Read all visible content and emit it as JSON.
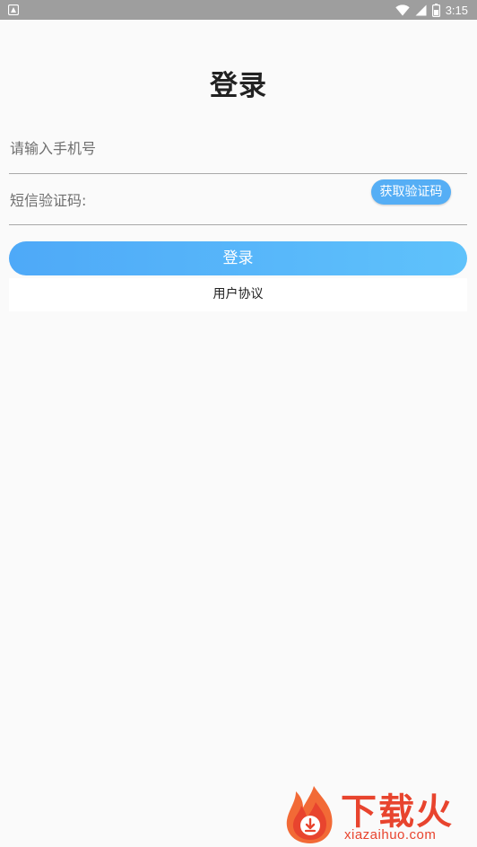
{
  "status_bar": {
    "time": "3:15",
    "icons": [
      "app-notification-icon",
      "wifi-icon",
      "signal-icon",
      "battery-icon"
    ]
  },
  "page": {
    "title": "登录"
  },
  "form": {
    "phone_placeholder": "请输入手机号",
    "phone_value": "",
    "code_placeholder": "短信验证码:",
    "code_value": "",
    "get_code_label": "获取验证码",
    "login_label": "登录",
    "agreement_label": "用户协议"
  },
  "watermark": {
    "brand": "下载火",
    "url": "xiazaihuo.com"
  },
  "colors": {
    "accent": "#55aef5",
    "gradient_start": "#4ea9f8",
    "gradient_end": "#5fc2fb",
    "watermark": "#e8442e",
    "status_bar": "#9e9e9e"
  }
}
